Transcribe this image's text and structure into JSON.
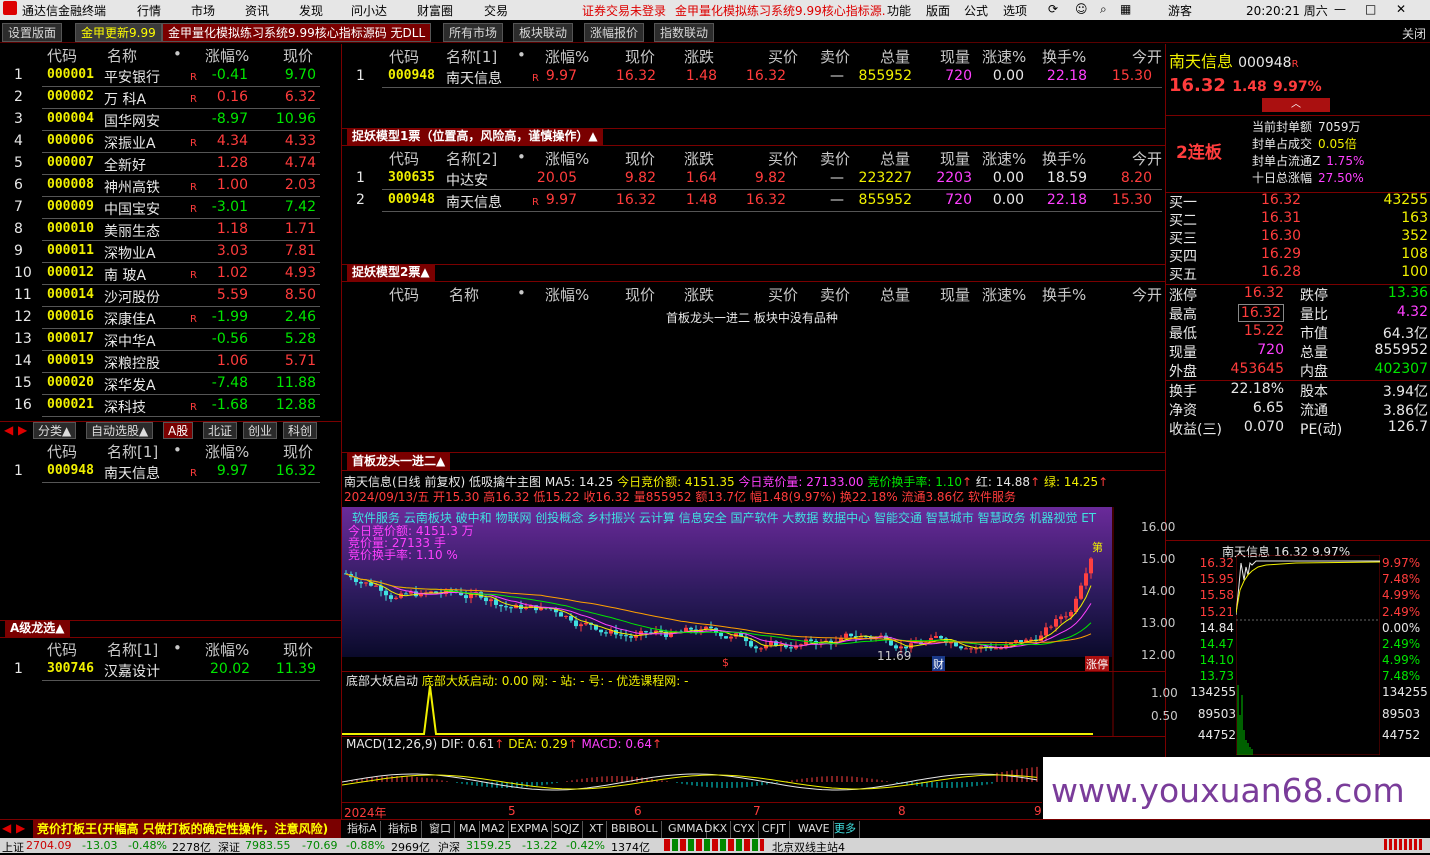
{
  "window": {
    "app_title": "通达信金融终端",
    "user": "游客",
    "clock": "20:20:21 周六"
  },
  "menu": [
    "行情",
    "市场",
    "资讯",
    "发现",
    "问小达",
    "财富圈",
    "交易"
  ],
  "menu_notice": "证券交易未登录",
  "menu_ad": "金甲量化模拟练习系统9.99核心指标源...",
  "menu_right": [
    "功能",
    "版面",
    "公式",
    "选项"
  ],
  "tabs": [
    "设置版面",
    "金甲更新9.99",
    "金甲量化模拟练习系统9.99核心指标源码 无DLL",
    "所有市场",
    "板块联动",
    "涨幅报价",
    "指数联动"
  ],
  "close_label": "关闭",
  "left_list": {
    "headers": [
      "代码",
      "名称",
      "涨幅%",
      "现价"
    ],
    "rows": [
      {
        "n": "1",
        "code": "000001",
        "name": "平安银行",
        "r": "R",
        "chg": "-0.41",
        "price": "9.70",
        "up": false
      },
      {
        "n": "2",
        "code": "000002",
        "name": "万 科A",
        "r": "R",
        "chg": "0.16",
        "price": "6.32",
        "up": true
      },
      {
        "n": "3",
        "code": "000004",
        "name": "国华网安",
        "r": "",
        "chg": "-8.97",
        "price": "10.96",
        "up": false
      },
      {
        "n": "4",
        "code": "000006",
        "name": "深振业A",
        "r": "R",
        "chg": "4.34",
        "price": "4.33",
        "up": true
      },
      {
        "n": "5",
        "code": "000007",
        "name": "全新好",
        "r": "",
        "chg": "1.28",
        "price": "4.74",
        "up": true
      },
      {
        "n": "6",
        "code": "000008",
        "name": "神州高铁",
        "r": "R",
        "chg": "1.00",
        "price": "2.03",
        "up": true
      },
      {
        "n": "7",
        "code": "000009",
        "name": "中国宝安",
        "r": "R",
        "chg": "-3.01",
        "price": "7.42",
        "up": false
      },
      {
        "n": "8",
        "code": "000010",
        "name": "美丽生态",
        "r": "",
        "chg": "1.18",
        "price": "1.71",
        "up": true
      },
      {
        "n": "9",
        "code": "000011",
        "name": "深物业A",
        "r": "",
        "chg": "3.03",
        "price": "7.81",
        "up": true
      },
      {
        "n": "10",
        "code": "000012",
        "name": "南 玻A",
        "r": "R",
        "chg": "1.02",
        "price": "4.93",
        "up": true
      },
      {
        "n": "11",
        "code": "000014",
        "name": "沙河股份",
        "r": "",
        "chg": "5.59",
        "price": "8.50",
        "up": true
      },
      {
        "n": "12",
        "code": "000016",
        "name": "深康佳A",
        "r": "R",
        "chg": "-1.99",
        "price": "2.46",
        "up": false
      },
      {
        "n": "13",
        "code": "000017",
        "name": "深中华A",
        "r": "",
        "chg": "-0.56",
        "price": "5.28",
        "up": false
      },
      {
        "n": "14",
        "code": "000019",
        "name": "深粮控股",
        "r": "",
        "chg": "1.06",
        "price": "5.71",
        "up": true
      },
      {
        "n": "15",
        "code": "000020",
        "name": "深华发A",
        "r": "",
        "chg": "-7.48",
        "price": "11.88",
        "up": false
      },
      {
        "n": "16",
        "code": "000021",
        "name": "深科技",
        "r": "R",
        "chg": "-1.68",
        "price": "12.88",
        "up": false
      }
    ]
  },
  "left_subtabs": [
    "分类▲",
    "自动选股▲",
    "A股",
    "北证",
    "创业",
    "科创"
  ],
  "left_list2": {
    "headers": [
      "代码",
      "名称[1]",
      "涨幅%",
      "现价"
    ],
    "rows": [
      {
        "n": "1",
        "code": "000948",
        "name": "南天信息",
        "r": "R",
        "chg": "9.97",
        "price": "16.32"
      }
    ]
  },
  "a_level_title": "A级龙选▲",
  "left_list3": {
    "headers": [
      "代码",
      "名称[1]",
      "涨幅%",
      "现价"
    ],
    "rows": [
      {
        "n": "1",
        "code": "300746",
        "name": "汉嘉设计",
        "r": "",
        "chg": "20.02",
        "price": "11.39"
      }
    ]
  },
  "mid_headers": [
    "代码",
    "名称[1]",
    "涨幅%",
    "现价",
    "涨跌",
    "买价",
    "卖价",
    "总量",
    "现量",
    "涨速%",
    "换手%",
    "今开"
  ],
  "mid_table1": [
    {
      "n": "1",
      "code": "000948",
      "name": "南天信息",
      "r": "R",
      "chg": "9.97",
      "price": "16.32",
      "diff": "1.48",
      "bid": "16.32",
      "ask": "—",
      "vol": "855952",
      "cur": "720",
      "speed": "0.00",
      "turn": "22.18",
      "open": "15.30"
    }
  ],
  "model1_title": "捉妖模型1票（位置高，风险高，谨慎操作）▲",
  "mid_headers2": [
    "代码",
    "名称[2]",
    "涨幅%",
    "现价",
    "涨跌",
    "买价",
    "卖价",
    "总量",
    "现量",
    "涨速%",
    "换手%",
    "今开"
  ],
  "mid_table2": [
    {
      "n": "1",
      "code": "300635",
      "name": "中达安",
      "r": "",
      "chg": "20.05",
      "price": "9.82",
      "diff": "1.64",
      "bid": "9.82",
      "ask": "—",
      "vol": "223227",
      "cur": "2203",
      "speed": "0.00",
      "turn": "18.59",
      "open": "8.20"
    },
    {
      "n": "2",
      "code": "000948",
      "name": "南天信息",
      "r": "R",
      "chg": "9.97",
      "price": "16.32",
      "diff": "1.48",
      "bid": "16.32",
      "ask": "—",
      "vol": "855952",
      "cur": "720",
      "speed": "0.00",
      "turn": "22.18",
      "open": "15.30"
    }
  ],
  "model2_title": "捉妖模型2票▲",
  "mid_headers3": [
    "代码",
    "名称",
    "•",
    "涨幅%",
    "现价",
    "涨跌",
    "买价",
    "卖价",
    "总量",
    "现量",
    "涨速%",
    "换手%",
    "今开"
  ],
  "empty_msg": "首板龙头一进二 板块中没有品种",
  "chart_panel_title": "首板龙头一进二▲",
  "chart_info1": {
    "name": "南天信息(日线 前复权)",
    "ind": "低吸擒牛主图",
    "ma5": "MA5: 14.25",
    "bid_amt": "今日竞价额: 4151.35",
    "bid_vol": "今日竞价量: 27133.00",
    "bid_turn": "竞价换手率: 1.10",
    "red": "红: 14.88",
    "green": "绿: 14.25"
  },
  "chart_info2": "2024/09/13/五 开15.30 高16.32 低15.22 收16.32 量855952 额13.7亿 幅1.48(9.97%) 换22.18% 流通3.86亿 软件服务",
  "concepts": "软件服务 云南板块 破中和 物联网 创投概念 乡村振兴 云计算 信息安全 国产软件 大数据 数据中心 智能交通 智慧城市 智慧政务 机器视觉 ET",
  "chart_overlay": [
    "今日竞价额: 4151.3 万",
    "竞价量: 27133 手",
    "竞价换手率: 1.10 %"
  ],
  "chart_yaxis": [
    "16.00",
    "15.00",
    "14.00",
    "13.00",
    "12.00"
  ],
  "chart_low": "11.69",
  "chart_labels": {
    "first": "第",
    "zt": "涨停",
    "cai": "财",
    "s": "$"
  },
  "ind1": {
    "name": "底部大妖启动",
    "text": "底部大妖启动: 0.00 网: - 站: - 号: - 优选课程网: -",
    "y": [
      "1.00",
      "0.50"
    ]
  },
  "ind2": {
    "name": "MACD(12,26,9)",
    "dif": "DIF: 0.61",
    "dea": "DEA: 0.29",
    "macd": "MACD: 0.64"
  },
  "xaxis": [
    "2024年",
    "5",
    "6",
    "7",
    "8",
    "9"
  ],
  "bottom_tabs": [
    "指标A",
    "指标B",
    "窗口",
    "MA",
    "MA2",
    "EXPMA",
    "SQJZ",
    "XT",
    "BBIBOLL",
    "GMMA",
    "DKX",
    "CYX",
    "CFJT",
    "WAVE",
    "更多"
  ],
  "bottom_ticker": "竞价打板王(开幅高 只做打板的确定性操作，注意风险)",
  "stock": {
    "name": "南天信息",
    "code": "000948",
    "r": "R",
    "price": "16.32",
    "diff": "1.48",
    "pct": "9.97%",
    "lianban": "2连板",
    "seal": [
      [
        "当前封单额",
        "7059万"
      ],
      [
        "封单占成交",
        "0.05倍"
      ],
      [
        "封单占流通Z",
        "1.75%"
      ],
      [
        "十日总涨幅",
        "27.50%"
      ]
    ],
    "sell_levels": [
      [
        "买一",
        "16.32",
        "43255"
      ],
      [
        "买二",
        "16.31",
        "163"
      ],
      [
        "买三",
        "16.30",
        "352"
      ],
      [
        "买四",
        "16.29",
        "108"
      ],
      [
        "买五",
        "16.28",
        "100"
      ]
    ],
    "stats": [
      [
        "涨停",
        "16.32",
        "跌停",
        "13.36"
      ],
      [
        "最高",
        "16.32",
        "量比",
        "4.32"
      ],
      [
        "最低",
        "15.22",
        "市值",
        "64.3亿"
      ],
      [
        "现量",
        "720",
        "总量",
        "855952"
      ],
      [
        "外盘",
        "453645",
        "内盘",
        "402307"
      ]
    ],
    "stats2": [
      [
        "换手",
        "22.18%",
        "股本",
        "3.94亿"
      ],
      [
        "净资",
        "6.65",
        "流通",
        "3.86亿"
      ],
      [
        "收益(三)",
        "0.070",
        "PE(动)",
        "126.7"
      ]
    ],
    "mini_title": "南天信息 16.32 9.97%",
    "mini_left": [
      "16.32",
      "15.95",
      "15.58",
      "15.21",
      "14.84",
      "14.47",
      "14.10",
      "13.73"
    ],
    "mini_right": [
      "9.97%",
      "7.48%",
      "4.99%",
      "2.49%",
      "0.00%",
      "2.49%",
      "4.99%",
      "7.48%"
    ],
    "mini_vol": [
      "134255",
      "89503",
      "44752"
    ]
  },
  "watermark": "www.youxuan68.com",
  "status": {
    "sh": "上证",
    "sh_v": "2704.09",
    "sh_d": "-13.03",
    "sh_p": "-0.48%",
    "sh_a": "2278亿",
    "sz": "深证",
    "sz_v": "7983.55",
    "sz_d": "-70.69",
    "sz_p": "-0.88%",
    "sz_a": "2969亿",
    "hs": "沪深",
    "hs_v": "3159.25",
    "hs_d": "-13.22",
    "hs_p": "-0.42%",
    "hs_a": "1374亿",
    "site": "北京双线主站4"
  }
}
